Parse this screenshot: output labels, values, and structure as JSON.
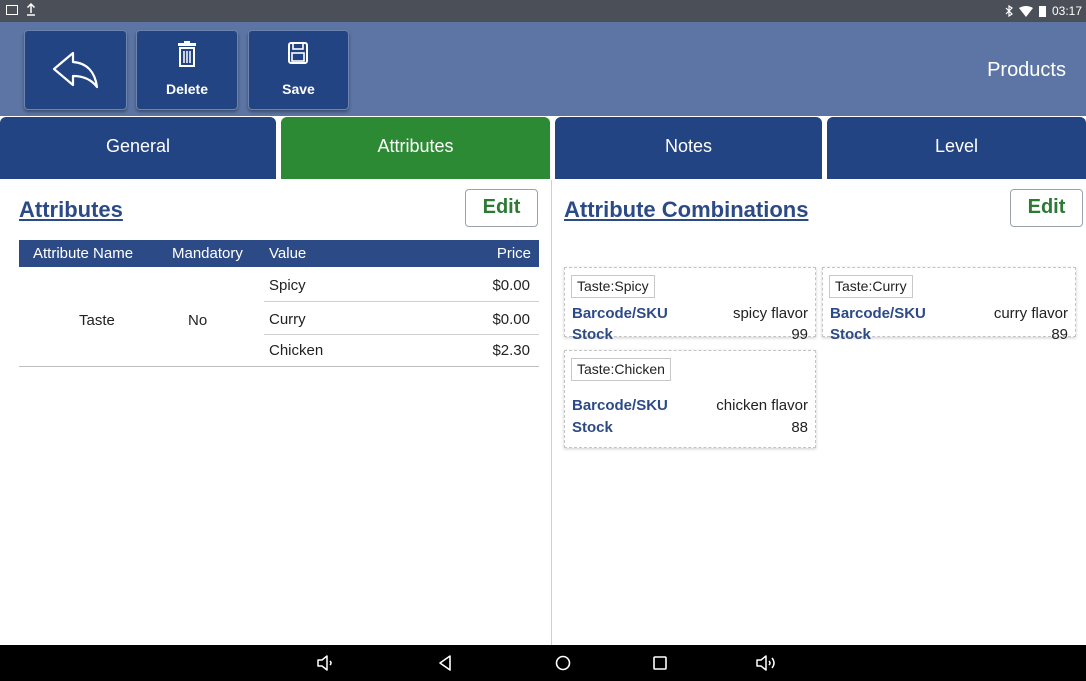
{
  "status_bar": {
    "time": "03:17",
    "left_icons": [
      "image-icon",
      "upload-icon"
    ],
    "right_icons": [
      "bluetooth-icon",
      "wifi-icon",
      "battery-icon"
    ]
  },
  "header": {
    "title": "Products",
    "back_icon": "back-arrow-icon",
    "delete_label": "Delete",
    "delete_icon": "trash-icon",
    "save_label": "Save",
    "save_icon": "floppy-disk-icon"
  },
  "tabs": [
    {
      "label": "General",
      "active": false
    },
    {
      "label": "Attributes",
      "active": true
    },
    {
      "label": "Notes",
      "active": false
    },
    {
      "label": "Level",
      "active": false
    }
  ],
  "attributes": {
    "title": "Attributes",
    "edit_label": "Edit",
    "columns": [
      "Attribute Name",
      "Mandatory",
      "Value",
      "Price"
    ],
    "rows": [
      {
        "name": "Taste",
        "mandatory": "No",
        "values": [
          {
            "value": "Spicy",
            "price": "$0.00"
          },
          {
            "value": "Curry",
            "price": "$0.00"
          },
          {
            "value": "Chicken",
            "price": "$2.30"
          }
        ]
      }
    ]
  },
  "combinations": {
    "title": "Attribute Combinations",
    "edit_label": "Edit",
    "barcode_label": "Barcode/SKU",
    "stock_label": "Stock",
    "items": [
      {
        "tag": "Taste:Spicy",
        "barcode": "spicy flavor",
        "stock": "99"
      },
      {
        "tag": "Taste:Curry",
        "barcode": "curry flavor",
        "stock": "89"
      },
      {
        "tag": "Taste:Chicken",
        "barcode": "chicken flavor",
        "stock": "88"
      }
    ]
  },
  "nav_bar": {
    "icons": [
      "volume-down-icon",
      "back-triangle-icon",
      "home-circle-icon",
      "recents-square-icon",
      "volume-up-icon"
    ]
  },
  "colors": {
    "header_bg": "#5c75a4",
    "button_bg": "#234482",
    "active_tab": "#2d8a34",
    "title_blue": "#2c4b86",
    "edit_green": "#2d7a35"
  }
}
